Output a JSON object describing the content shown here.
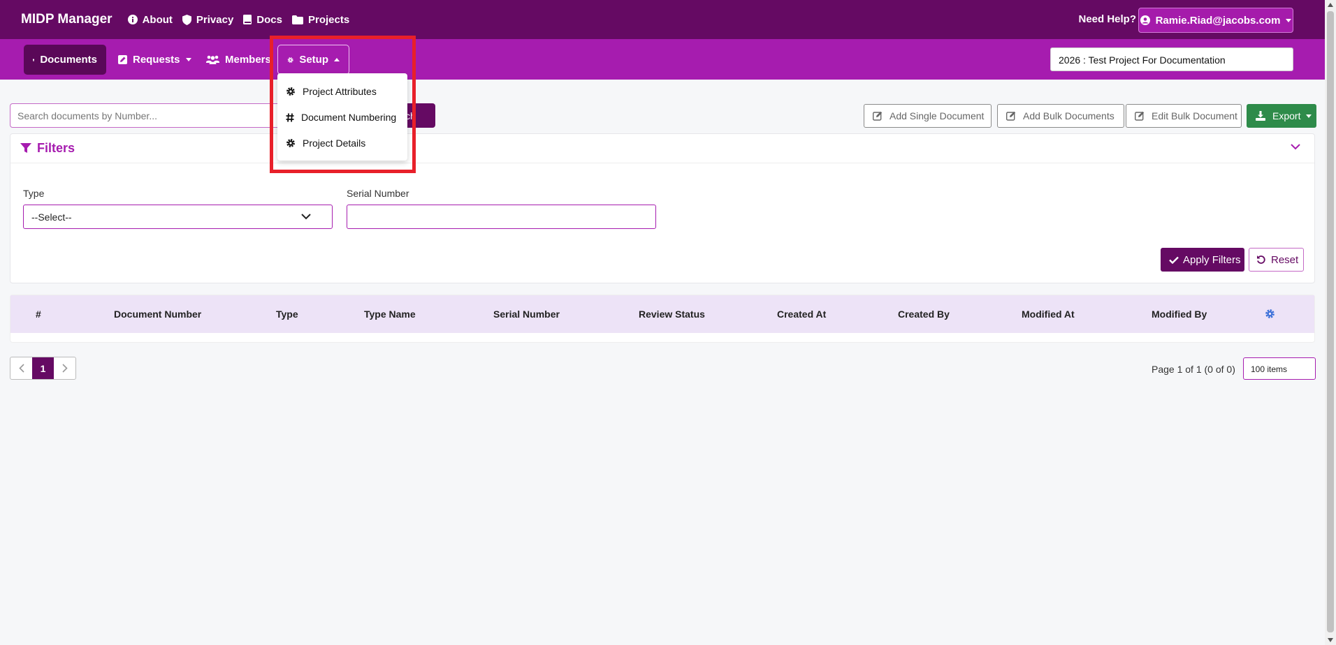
{
  "topbar": {
    "brand": "MIDP Manager",
    "links": [
      {
        "label": "About",
        "icon": "info-icon"
      },
      {
        "label": "Privacy",
        "icon": "shield-icon"
      },
      {
        "label": "Docs",
        "icon": "book-icon"
      },
      {
        "label": "Projects",
        "icon": "folder-icon"
      }
    ],
    "help": "Need Help?",
    "user": "Ramie.Riad@jacobs.com"
  },
  "subnav": {
    "documents": "Documents",
    "requests": "Requests",
    "members": "Members",
    "setup": "Setup",
    "project_selected": "2026 : Test Project For Documentation"
  },
  "setup_menu": {
    "items": [
      {
        "label": "Project Attributes",
        "icon": "gear-icon"
      },
      {
        "label": "Document Numbering",
        "icon": "hash-icon"
      },
      {
        "label": "Project Details",
        "icon": "gear-icon"
      }
    ]
  },
  "search": {
    "placeholder": "Search documents by Number...",
    "button_partial": "ch"
  },
  "toolbar": {
    "add_single": "Add Single Document",
    "add_bulk": "Add Bulk Documents",
    "edit_bulk": "Edit Bulk Document",
    "export": "Export"
  },
  "filters": {
    "title": "Filters",
    "type_label": "Type",
    "type_value": "--Select--",
    "serial_label": "Serial Number",
    "serial_value": "",
    "apply": "Apply Filters",
    "reset": "Reset"
  },
  "table": {
    "columns": [
      "#",
      "Document Number",
      "Type",
      "Type Name",
      "Serial Number",
      "Review Status",
      "Created At",
      "Created By",
      "Modified At",
      "Modified By"
    ]
  },
  "pagination": {
    "current_page": "1",
    "info": "Page 1 of 1 (0 of 0)",
    "page_size": "100 items"
  },
  "colors": {
    "primary_dark": "#650a63",
    "primary": "#a61caf",
    "highlight": "#e8202a",
    "export_green": "#2e8b4a"
  }
}
